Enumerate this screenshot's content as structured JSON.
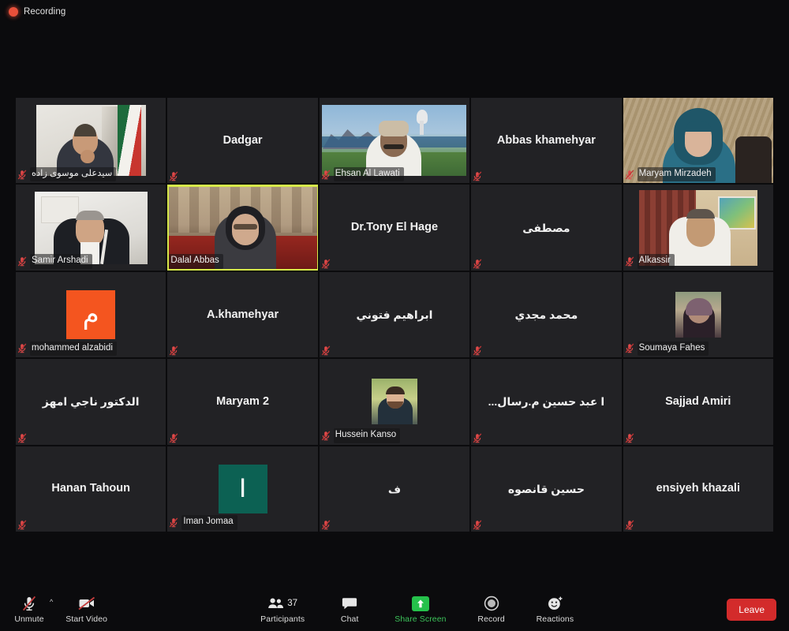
{
  "recording": {
    "label": "Recording",
    "dot_color": "#e8503a"
  },
  "accents": {
    "active_speaker_border": "#d6e84a",
    "active_speaker_inner": "#5ec94a",
    "share_screen_green": "#3cc35a",
    "leave_red": "#d32b2b",
    "muted_mic_red": "#e04a4a",
    "avatar_orange": "#f4551f",
    "avatar_teal": "#0c6153"
  },
  "gallery": {
    "columns": 5,
    "rows": 5,
    "tiles": [
      {
        "name": "سیدعلی موسوی زاده",
        "rtl": true,
        "display": "video",
        "muted": true,
        "active": false,
        "name_position": "footer",
        "video_style": "office-flags"
      },
      {
        "name": "Dadgar",
        "rtl": false,
        "display": "name",
        "muted": true,
        "active": false,
        "name_position": "center"
      },
      {
        "name": "Ehsan Al Lawati",
        "rtl": false,
        "display": "video",
        "muted": true,
        "active": false,
        "name_position": "footer",
        "video_style": "mountain-bay"
      },
      {
        "name": "Abbas khamehyar",
        "rtl": false,
        "display": "name",
        "muted": true,
        "active": false,
        "name_position": "center"
      },
      {
        "name": "Maryam Mirzadeh",
        "rtl": false,
        "display": "video",
        "muted": true,
        "active": false,
        "name_position": "footer",
        "video_style": "beige-wall"
      },
      {
        "name": "Samir Arshadi",
        "rtl": false,
        "display": "video",
        "muted": true,
        "active": false,
        "name_position": "footer",
        "video_style": "white-room"
      },
      {
        "name": "Dalal Abbas",
        "rtl": false,
        "display": "video",
        "muted": false,
        "active": true,
        "name_position": "footer",
        "video_style": "red-carpet"
      },
      {
        "name": "Dr.Tony El Hage",
        "rtl": false,
        "display": "name",
        "muted": true,
        "active": false,
        "name_position": "center"
      },
      {
        "name": "مصطفى",
        "rtl": true,
        "display": "name",
        "muted": true,
        "active": false,
        "name_position": "center"
      },
      {
        "name": "Alkassir",
        "rtl": false,
        "display": "video",
        "muted": true,
        "active": false,
        "name_position": "footer",
        "video_style": "curtain-room"
      },
      {
        "name": "mohammed alzabidi",
        "rtl": false,
        "display": "avatar-letter",
        "avatar_letter": "م",
        "avatar_color": "#f4551f",
        "muted": true,
        "active": false,
        "name_position": "footer"
      },
      {
        "name": "A.khamehyar",
        "rtl": false,
        "display": "name",
        "muted": true,
        "active": false,
        "name_position": "center"
      },
      {
        "name": "ابراهيم فتوني",
        "rtl": true,
        "display": "name",
        "muted": true,
        "active": false,
        "name_position": "center"
      },
      {
        "name": "محمد مجدي",
        "rtl": true,
        "display": "name",
        "muted": true,
        "active": false,
        "name_position": "center"
      },
      {
        "name": "Soumaya Fahes",
        "rtl": false,
        "display": "avatar-photo",
        "avatar_photo": "woman-scarf",
        "muted": true,
        "active": false,
        "name_position": "footer"
      },
      {
        "name": "الدكتور ناجي امهز",
        "rtl": true,
        "display": "name",
        "muted": true,
        "active": false,
        "name_position": "center"
      },
      {
        "name": "Maryam 2",
        "rtl": false,
        "display": "name",
        "muted": true,
        "active": false,
        "name_position": "center"
      },
      {
        "name": "Hussein Kanso",
        "rtl": false,
        "display": "avatar-photo",
        "avatar_photo": "man-outdoor",
        "muted": true,
        "active": false,
        "name_position": "footer"
      },
      {
        "name": "ا عبد حسين م.رسال...",
        "rtl": true,
        "display": "name",
        "muted": true,
        "active": false,
        "name_position": "center"
      },
      {
        "name": "Sajjad Amiri",
        "rtl": false,
        "display": "name",
        "muted": true,
        "active": false,
        "name_position": "center"
      },
      {
        "name": "Hanan Tahoun",
        "rtl": false,
        "display": "name",
        "muted": true,
        "active": false,
        "name_position": "center"
      },
      {
        "name": "Iman Jomaa",
        "rtl": false,
        "display": "avatar-letter",
        "avatar_letter": "I",
        "avatar_color": "#0c6153",
        "muted": true,
        "active": false,
        "name_position": "footer"
      },
      {
        "name": "ف",
        "rtl": true,
        "display": "name",
        "muted": true,
        "active": false,
        "name_position": "center"
      },
      {
        "name": "حسين قانصوه",
        "rtl": true,
        "display": "name",
        "muted": true,
        "active": false,
        "name_position": "center"
      },
      {
        "name": "ensiyeh khazali",
        "rtl": false,
        "display": "name",
        "muted": true,
        "active": false,
        "name_position": "center"
      }
    ]
  },
  "toolbar": {
    "audio": {
      "label": "Unmute",
      "icon": "mic-muted-icon",
      "has_caret": true
    },
    "video": {
      "label": "Start Video",
      "icon": "video-off-icon"
    },
    "participants": {
      "label": "Participants",
      "count": "37",
      "icon": "participants-icon"
    },
    "chat": {
      "label": "Chat",
      "icon": "chat-icon"
    },
    "share_screen": {
      "label": "Share Screen",
      "icon": "share-screen-icon",
      "highlighted": true
    },
    "record": {
      "label": "Record",
      "icon": "record-icon"
    },
    "reactions": {
      "label": "Reactions",
      "icon": "reactions-icon"
    },
    "leave": {
      "label": "Leave"
    }
  }
}
